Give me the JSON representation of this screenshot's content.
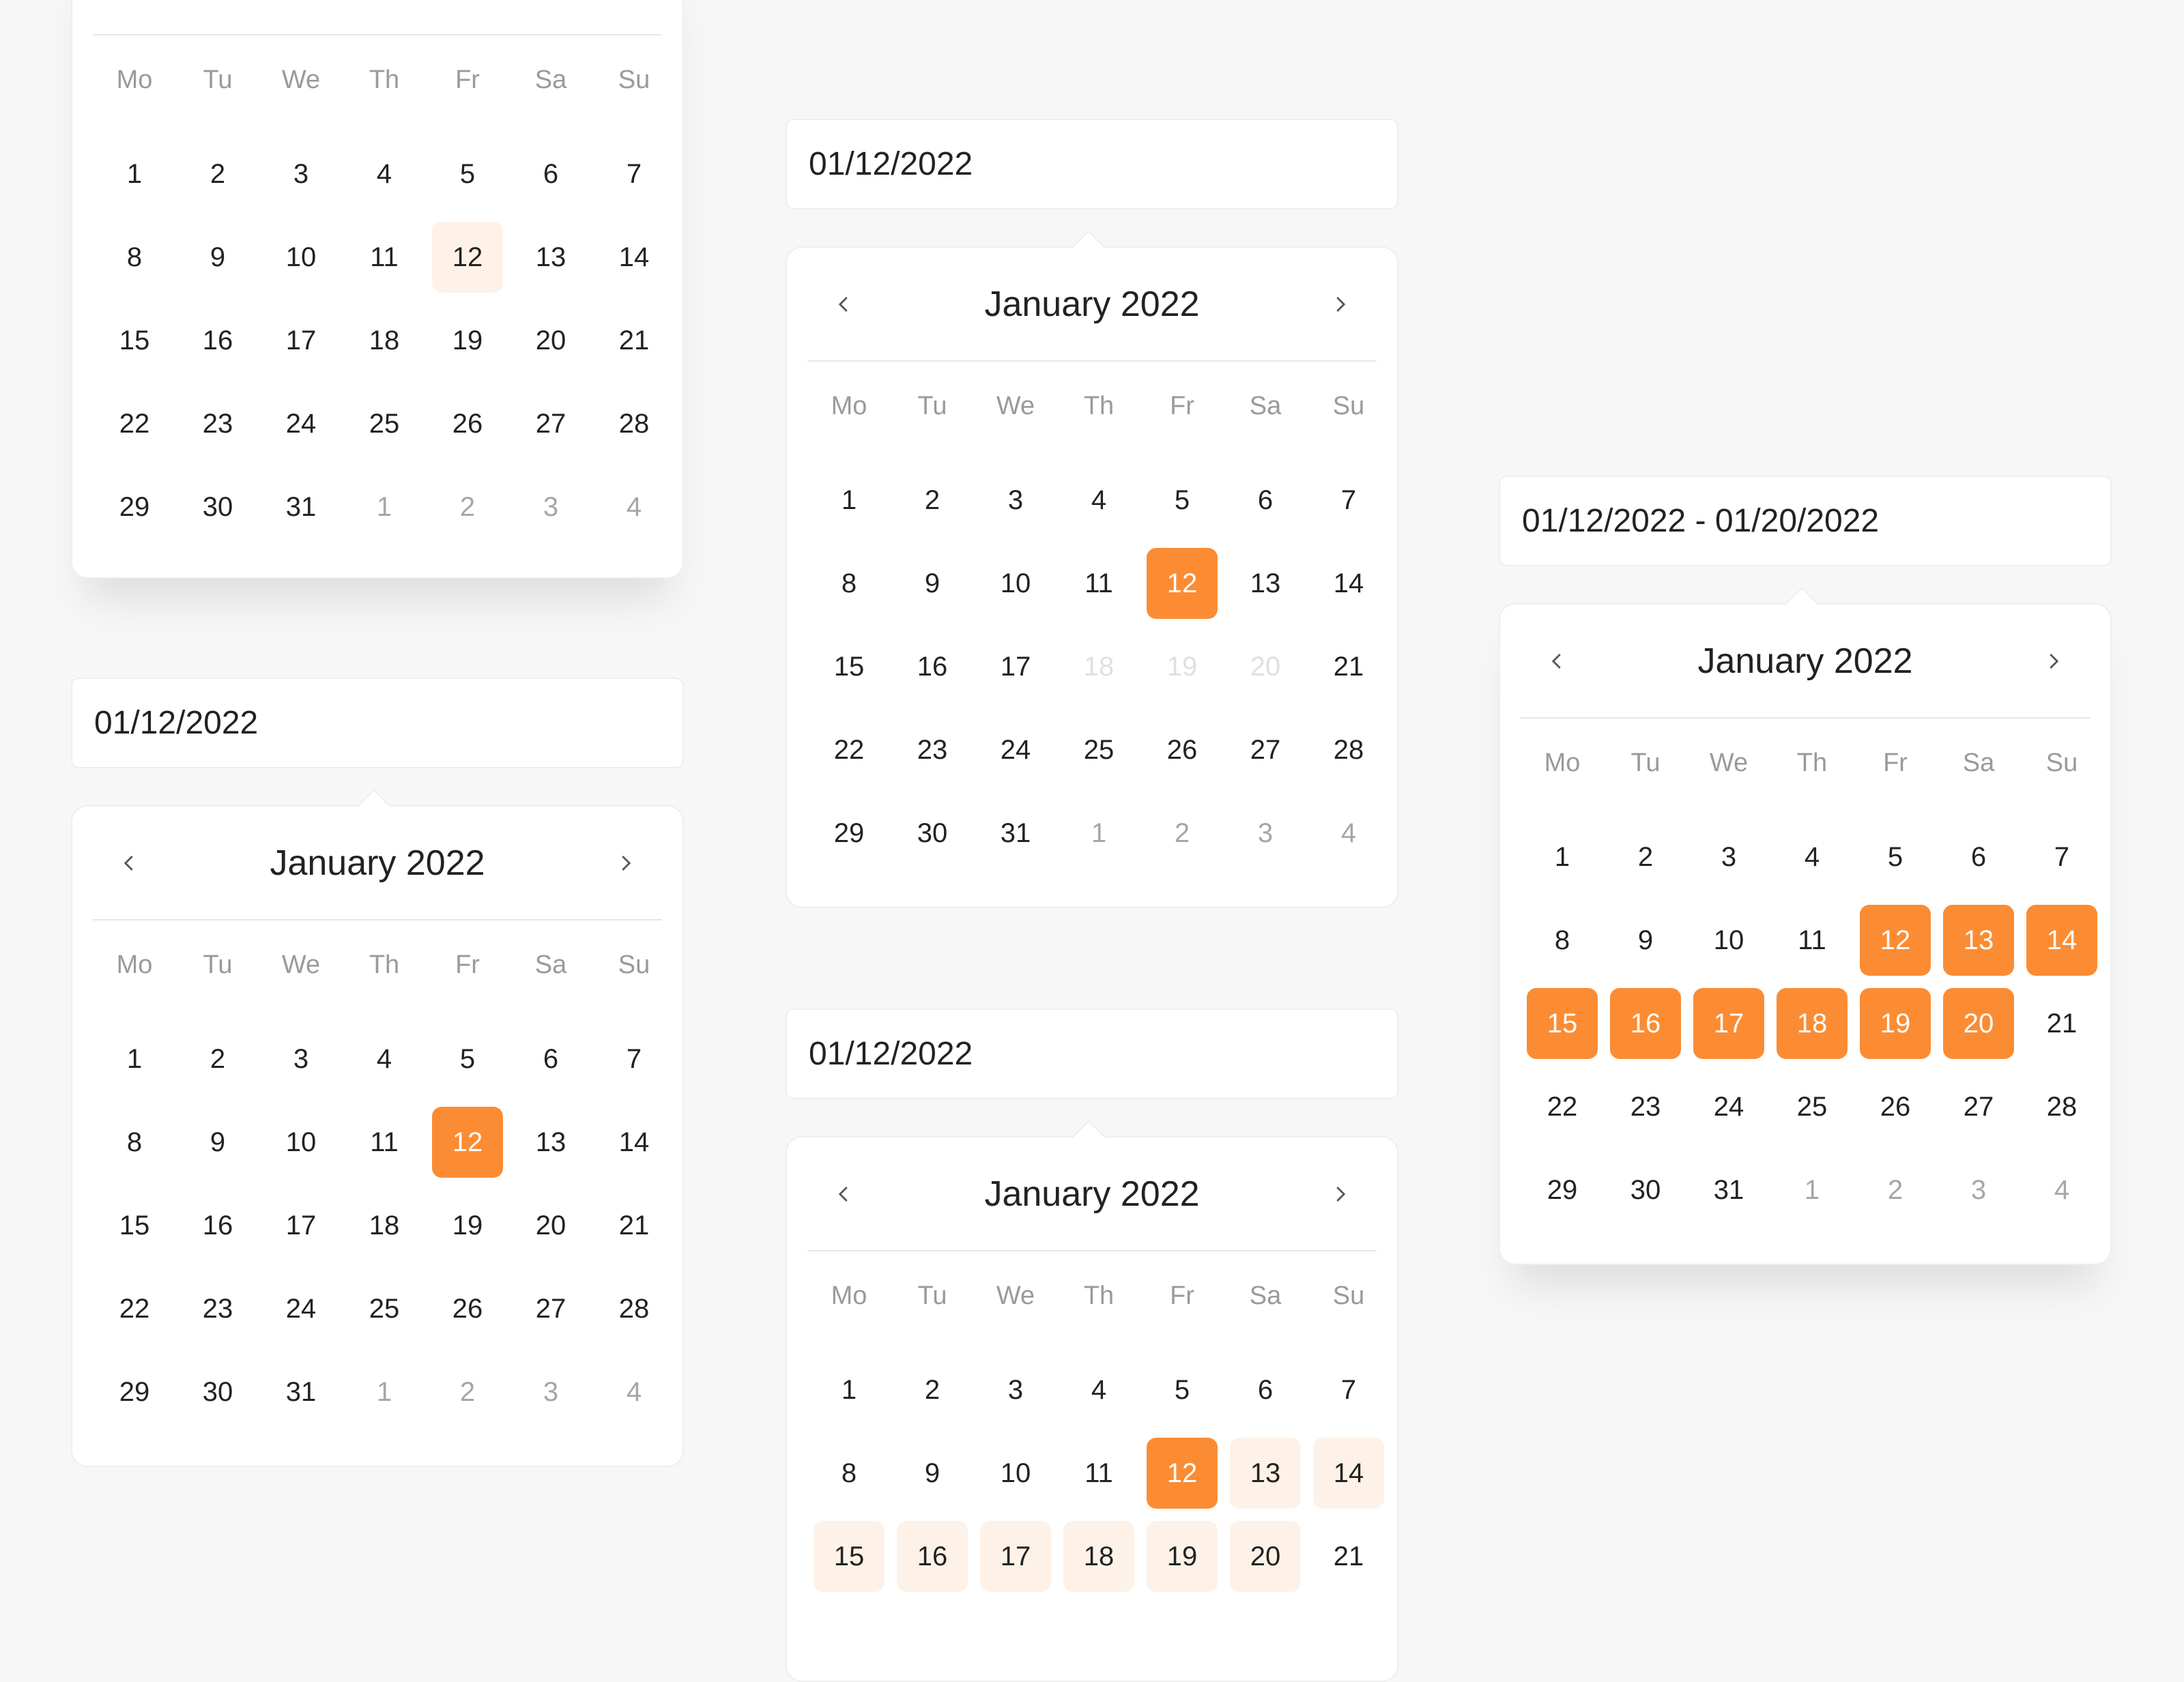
{
  "colors": {
    "accent": "#fb8c33",
    "accent_soft": "#fef2e8",
    "background": "#f7f7f7"
  },
  "month_title": "January 2022",
  "weekdays": [
    "Mo",
    "Tu",
    "We",
    "Th",
    "Fr",
    "Sa",
    "Su"
  ],
  "icons": {
    "prev": "chevron-left-icon",
    "next": "chevron-right-icon"
  },
  "days": [
    [
      "1",
      "2",
      "3",
      "4",
      "5",
      "6",
      "7"
    ],
    [
      "8",
      "9",
      "10",
      "11",
      "12",
      "13",
      "14"
    ],
    [
      "15",
      "16",
      "17",
      "18",
      "19",
      "20",
      "21"
    ],
    [
      "22",
      "23",
      "24",
      "25",
      "26",
      "27",
      "28"
    ],
    [
      "29",
      "30",
      "31",
      "1",
      "2",
      "3",
      "4"
    ]
  ],
  "pickers": {
    "top_left": {
      "state": "hover-12"
    },
    "bottom_left": {
      "input_value": "01/12/2022",
      "state": "selected-12"
    },
    "middle": {
      "input_value": "01/12/2022",
      "state": "selected-12-disabled-18-20"
    },
    "bottom_middle": {
      "input_value": "01/12/2022",
      "state": "range-hover-12-20"
    },
    "right": {
      "input_value": "01/12/2022 - 01/20/2022",
      "state": "range-selected-12-20"
    }
  }
}
